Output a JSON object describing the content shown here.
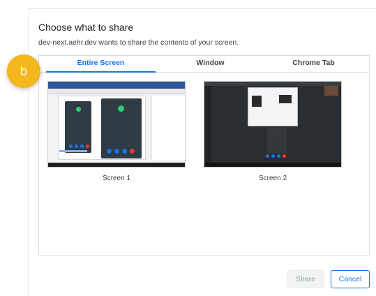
{
  "dialog": {
    "title": "Choose what to share",
    "subtitle": "dev-next.aehr.dev wants to share the contents of your screen."
  },
  "tabs": [
    {
      "label": "Entire Screen",
      "active": true
    },
    {
      "label": "Window",
      "active": false
    },
    {
      "label": "Chrome Tab",
      "active": false
    }
  ],
  "screens": [
    {
      "label": "Screen 1"
    },
    {
      "label": "Screen 2"
    }
  ],
  "marker": {
    "label": "b",
    "color": "#f3b61c"
  },
  "buttons": {
    "share_label": "Share",
    "cancel_label": "Cancel"
  },
  "colors": {
    "accent": "#1a73e8",
    "marker": "#f3b61c"
  }
}
